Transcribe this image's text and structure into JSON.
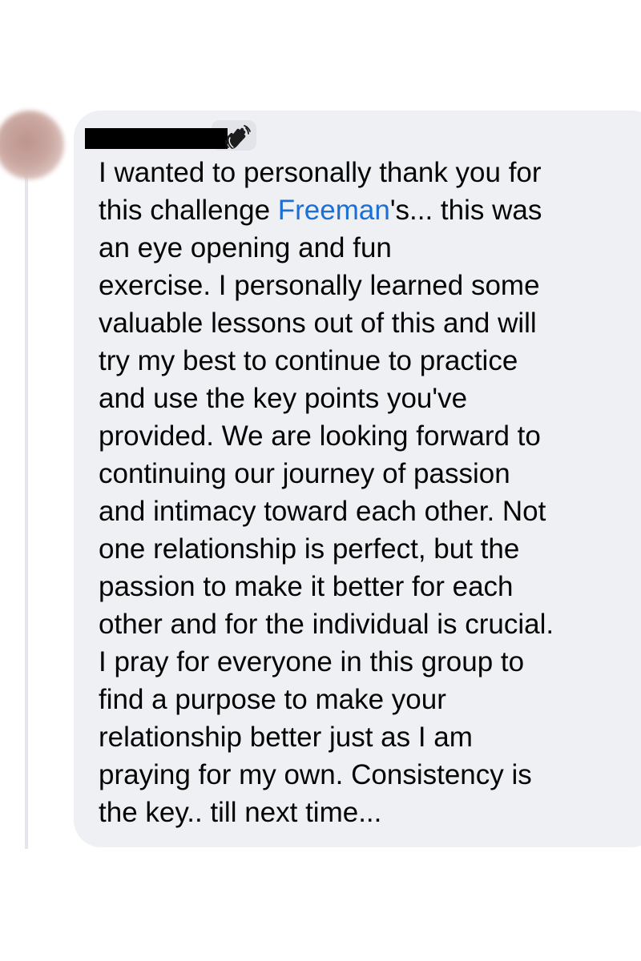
{
  "comment": {
    "author_name_redacted": true,
    "badge_icon": "waving-hand-icon",
    "mention_name": "Freeman",
    "lines": [
      {
        "text": "I wanted to personally thank you for"
      },
      {
        "before": "this challenge ",
        "mention": "Freeman",
        "after": "'s... this was"
      },
      {
        "text": "an eye opening and fun"
      },
      {
        "text": "exercise. I personally learned some"
      },
      {
        "text": "valuable lessons out of this and will"
      },
      {
        "text": "try my best to continue to practice"
      },
      {
        "text": "and use the key points you've"
      },
      {
        "text": "provided. We are looking forward to"
      },
      {
        "text": "continuing our journey of passion"
      },
      {
        "text": "and intimacy toward each other. Not"
      },
      {
        "text": "one relationship is perfect, but the"
      },
      {
        "text": "passion to make it better for each"
      },
      {
        "text": "other and for the individual is crucial."
      },
      {
        "text": "I pray for everyone in this group to"
      },
      {
        "text": "find a purpose to make your"
      },
      {
        "text": "relationship better just as I am"
      },
      {
        "text": "praying for my own. Consistency is"
      },
      {
        "text": "the key.. till next time..."
      }
    ]
  },
  "colors": {
    "bubble_background": "#eff0f4",
    "mention_link": "#1b6fd6",
    "text": "#050505"
  }
}
